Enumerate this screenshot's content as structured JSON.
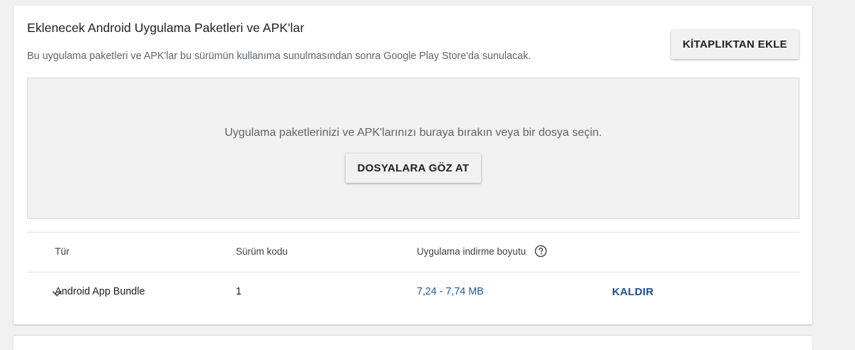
{
  "section": {
    "title": "Eklenecek Android Uygulama Paketleri ve APK'lar",
    "subtitle": "Bu uygulama paketleri ve APK'lar bu sürümün kullanıma sunulmasından sonra Google Play Store'da sunulacak.",
    "add_from_library_label": "KİTAPLIKTAN EKLE"
  },
  "dropzone": {
    "prompt": "Uygulama paketlerinizi ve APK'larınızı buraya bırakın veya bir dosya seçin.",
    "browse_label": "DOSYALARA GÖZ AT"
  },
  "table": {
    "columns": [
      "Tür",
      "Sürüm kodu",
      "Uygulama indirme boyutu"
    ],
    "rows": [
      {
        "type": "Android App Bundle",
        "version_code": "1",
        "download_size": "7,24 - 7,74 MB",
        "action_label": "KALDIR"
      }
    ]
  },
  "colors": {
    "link": "#1a5aa8",
    "action": "#1a4f9c"
  },
  "icons": {
    "help": "help-circle-icon",
    "expand": "chevron-down-icon"
  }
}
